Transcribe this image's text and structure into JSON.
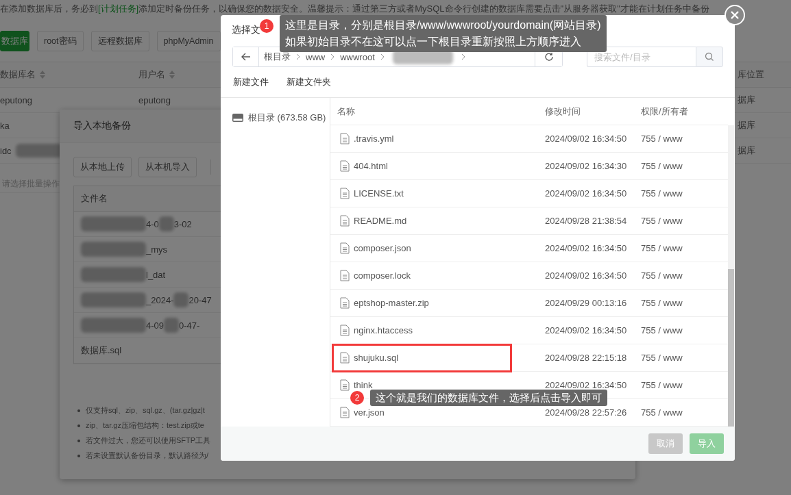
{
  "page": {
    "notice": {
      "before": "在添加数据库后，务必到",
      "link": "[计划任务]",
      "after": "添加定时备份任务，以确保您的数据安全。温馨提示：通过第三方或者MySQL命令行创建的数据库需要点击\"从服务器获取\"才能在计划任务中备份"
    },
    "toolbar": [
      {
        "label": "数据库",
        "kind": "primary"
      },
      {
        "label": "root密码",
        "kind": "default"
      },
      {
        "label": "远程数据库",
        "kind": "default"
      },
      {
        "label": "phpMyAdmin",
        "kind": "default"
      }
    ],
    "columns": [
      "数据库名",
      "用户名"
    ],
    "column_right": "库位置",
    "rows": [
      {
        "name": "eputong",
        "user": "eputong",
        "location": "据库",
        "blurred": false
      },
      {
        "name": "ka",
        "location": "据库",
        "blurred": false
      },
      {
        "name": "idc",
        "location": "据库",
        "blurred": true
      }
    ],
    "batch_select": {
      "placeholder": "请选择批量操作"
    }
  },
  "import_modal": {
    "title": "导入本地备份",
    "buttons": [
      "从本地上传",
      "从本机导入"
    ],
    "column": "文件名",
    "rows": [
      {
        "fragments": [
          "4-0",
          "3-02"
        ],
        "blurred": true
      },
      {
        "fragments": [
          "_mys"
        ],
        "blurred": true
      },
      {
        "fragments": [
          "l_dat"
        ],
        "blurred": true
      },
      {
        "fragments": [
          "_2024-",
          "20-47"
        ],
        "blurred": true
      },
      {
        "fragments": [
          "4-09",
          "0-47-"
        ],
        "blurred": true
      },
      {
        "fragments": [
          "数据库.sql"
        ],
        "blurred": false
      }
    ],
    "notes": [
      "仅支持sql、zip、sql.gz、(tar.gz|gz|t",
      "zip、tar.gz压缩包结构：test.zip或te",
      "若文件过大，您还可以使用SFTP工具",
      "若未设置默认备份目录，默认路径为/"
    ]
  },
  "file_dialog": {
    "title": "选择文",
    "breadcrumbs": [
      "根目录",
      "www",
      "wwwroot"
    ],
    "search": {
      "placeholder": "搜索文件/目录"
    },
    "actions": [
      "新建文件",
      "新建文件夹"
    ],
    "disk": "根目录 (673.58 GB)",
    "columns": [
      "名称",
      "修改时间",
      "权限/所有者"
    ],
    "files": [
      {
        "name": ".travis.yml",
        "time": "2024/09/02 16:34:50",
        "perm": "755 / www",
        "highlighted": false
      },
      {
        "name": "404.html",
        "time": "2024/09/02 16:34:30",
        "perm": "755 / www",
        "highlighted": false
      },
      {
        "name": "LICENSE.txt",
        "time": "2024/09/02 16:34:50",
        "perm": "755 / www",
        "highlighted": false
      },
      {
        "name": "README.md",
        "time": "2024/09/28 21:38:54",
        "perm": "755 / www",
        "highlighted": false
      },
      {
        "name": "composer.json",
        "time": "2024/09/02 16:34:50",
        "perm": "755 / www",
        "highlighted": false
      },
      {
        "name": "composer.lock",
        "time": "2024/09/02 16:34:50",
        "perm": "755 / www",
        "highlighted": false
      },
      {
        "name": "eptshop-master.zip",
        "time": "2024/09/29 00:13:16",
        "perm": "755 / www",
        "highlighted": false
      },
      {
        "name": "nginx.htaccess",
        "time": "2024/09/02 16:34:50",
        "perm": "755 / www",
        "highlighted": false
      },
      {
        "name": "shujuku.sql",
        "time": "2024/09/28 22:15:18",
        "perm": "755 / www",
        "highlighted": true
      },
      {
        "name": "think",
        "time": "2024/09/02 16:34:50",
        "perm": "755 / www",
        "highlighted": false
      },
      {
        "name": "ver.json",
        "time": "2024/09/28 22:57:26",
        "perm": "755 / www",
        "highlighted": false
      }
    ],
    "buttons": [
      {
        "label": "取消",
        "kind": "cancel",
        "disabled": false
      },
      {
        "label": "导入",
        "kind": "confirm",
        "disabled": true
      }
    ]
  },
  "callouts": [
    {
      "number": "1",
      "lines": [
        "这里是目录，分别是根目录/www/wwwroot/yourdomain(网站目录)",
        "如果初始目录不在这可以点一下根目录重新按照上方顺序进入"
      ]
    },
    {
      "number": "2",
      "lines": [
        "这个就是我们的数据库文件，选择后点击导入即可"
      ]
    }
  ]
}
